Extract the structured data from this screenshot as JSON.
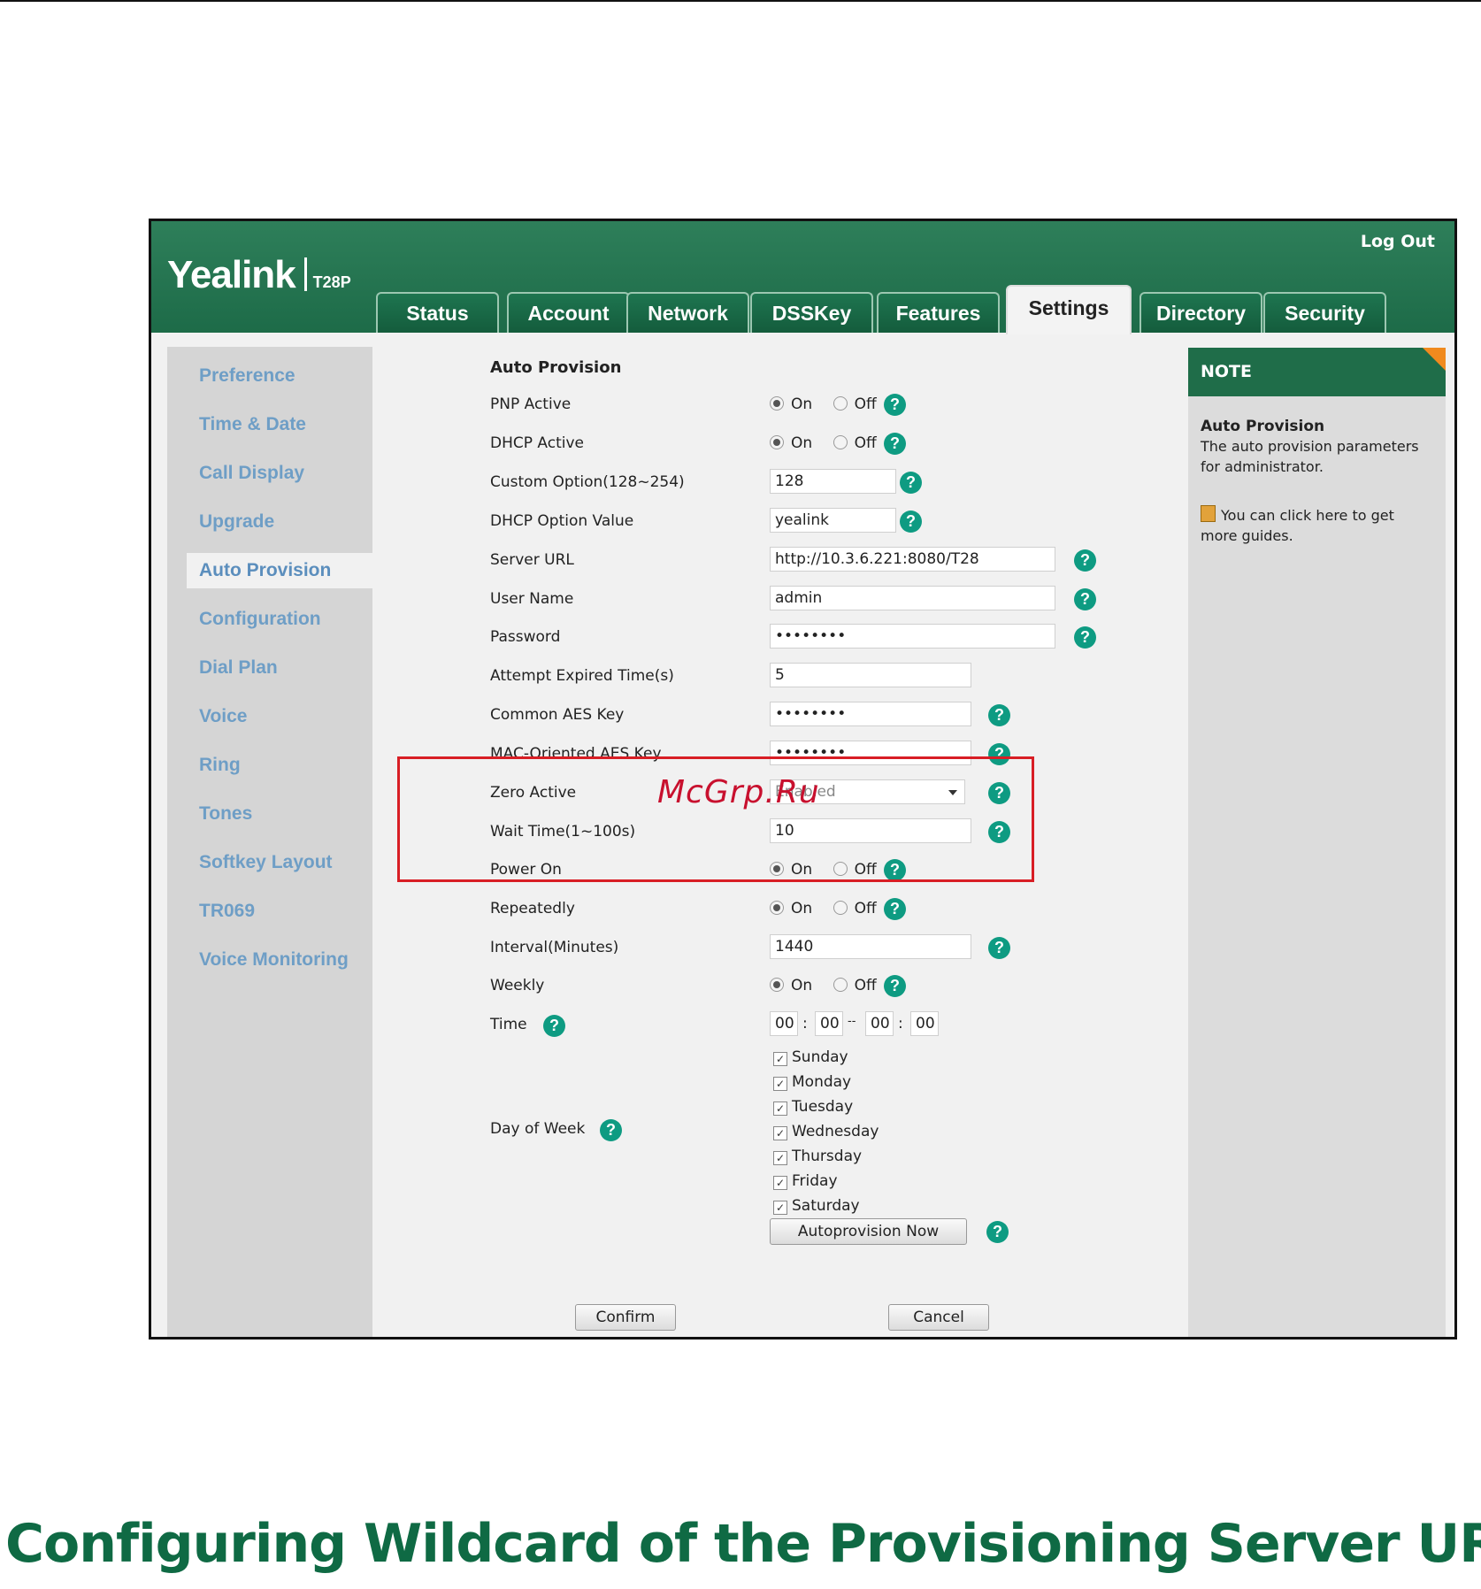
{
  "header": {
    "logo": "Yealink",
    "model": "T28P",
    "logout": "Log Out",
    "tabs": [
      "Status",
      "Account",
      "Network",
      "DSSKey",
      "Features",
      "Settings",
      "Directory",
      "Security"
    ],
    "active_tab": "Settings"
  },
  "sidebar": {
    "items": [
      "Preference",
      "Time & Date",
      "Call Display",
      "Upgrade",
      "Auto Provision",
      "Configuration",
      "Dial Plan",
      "Voice",
      "Ring",
      "Tones",
      "Softkey Layout",
      "TR069",
      "Voice Monitoring"
    ],
    "active": "Auto Provision"
  },
  "form": {
    "title": "Auto Provision",
    "on_label": "On",
    "off_label": "Off",
    "pnp_active": "PNP Active",
    "dhcp_active": "DHCP Active",
    "custom_option": {
      "label": "Custom Option(128~254)",
      "value": "128"
    },
    "dhcp_option_value": {
      "label": "DHCP Option Value",
      "value": "yealink"
    },
    "server_url": {
      "label": "Server URL",
      "value": "http://10.3.6.221:8080/T28"
    },
    "user_name": {
      "label": "User Name",
      "value": "admin"
    },
    "password": {
      "label": "Password",
      "value": "••••••••"
    },
    "attempt_expired": {
      "label": "Attempt Expired Time(s)",
      "value": "5"
    },
    "common_aes": {
      "label": "Common AES Key",
      "value": "••••••••"
    },
    "mac_aes": {
      "label": "MAC-Oriented AES Key",
      "value": "••••••••"
    },
    "zero_active": {
      "label": "Zero Active",
      "value": "Enabled"
    },
    "wait_time": {
      "label": "Wait Time(1~100s)",
      "value": "10"
    },
    "power_on": "Power On",
    "repeatedly": "Repeatedly",
    "interval": {
      "label": "Interval(Minutes)",
      "value": "1440"
    },
    "weekly": "Weekly",
    "time": {
      "label": "Time",
      "start_h": "00",
      "start_m": "00",
      "end_h": "00",
      "end_m": "00",
      "colon": ":",
      "dash": "--"
    },
    "day_of_week": {
      "label": "Day of Week",
      "days": [
        "Sunday",
        "Monday",
        "Tuesday",
        "Wednesday",
        "Thursday",
        "Friday",
        "Saturday"
      ]
    },
    "autoprovision_button": "Autoprovision Now",
    "confirm": "Confirm",
    "cancel": "Cancel",
    "help_glyph": "?"
  },
  "note": {
    "header": "NOTE",
    "title": "Auto Provision",
    "text": "The auto provision parameters for administrator.",
    "guide": "You can click here to get more guides."
  },
  "watermark": "McGrp.Ru",
  "page_heading": "Configuring Wildcard of the Provisioning Server URL",
  "colors": {
    "brand_green": "#1d6b48",
    "highlight_red": "#d81e25",
    "help_teal": "#0e9b82",
    "heading_green": "#0f6a44"
  }
}
